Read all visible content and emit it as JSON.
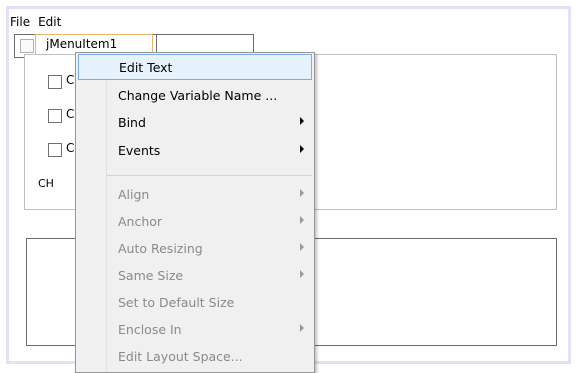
{
  "menubar": {
    "file": "File",
    "edit": "Edit"
  },
  "selected_item": {
    "label": "jMenuItem1"
  },
  "panel": {
    "checkbox_labels": [
      "C",
      "C",
      "C"
    ],
    "ch_label": "CH"
  },
  "context_menu": {
    "items": [
      {
        "label": "Edit Text",
        "enabled": true,
        "submenu": false,
        "highlighted": true
      },
      {
        "label": "Change Variable Name ...",
        "enabled": true,
        "submenu": false
      },
      {
        "label": "Bind",
        "enabled": true,
        "submenu": true
      },
      {
        "label": "Events",
        "enabled": true,
        "submenu": true
      },
      {
        "label": "Align",
        "enabled": false,
        "submenu": true
      },
      {
        "label": "Anchor",
        "enabled": false,
        "submenu": true
      },
      {
        "label": "Auto Resizing",
        "enabled": false,
        "submenu": true
      },
      {
        "label": "Same Size",
        "enabled": false,
        "submenu": true
      },
      {
        "label": "Set to Default Size",
        "enabled": false,
        "submenu": false
      },
      {
        "label": "Enclose In",
        "enabled": false,
        "submenu": true
      },
      {
        "label": "Edit Layout Space...",
        "enabled": false,
        "submenu": false
      }
    ]
  },
  "colors": {
    "highlight_bg": "#e5f1fb",
    "highlight_border": "#78aee5",
    "selection_border": "#e9b56c",
    "disabled_text": "#8a8a8a"
  }
}
